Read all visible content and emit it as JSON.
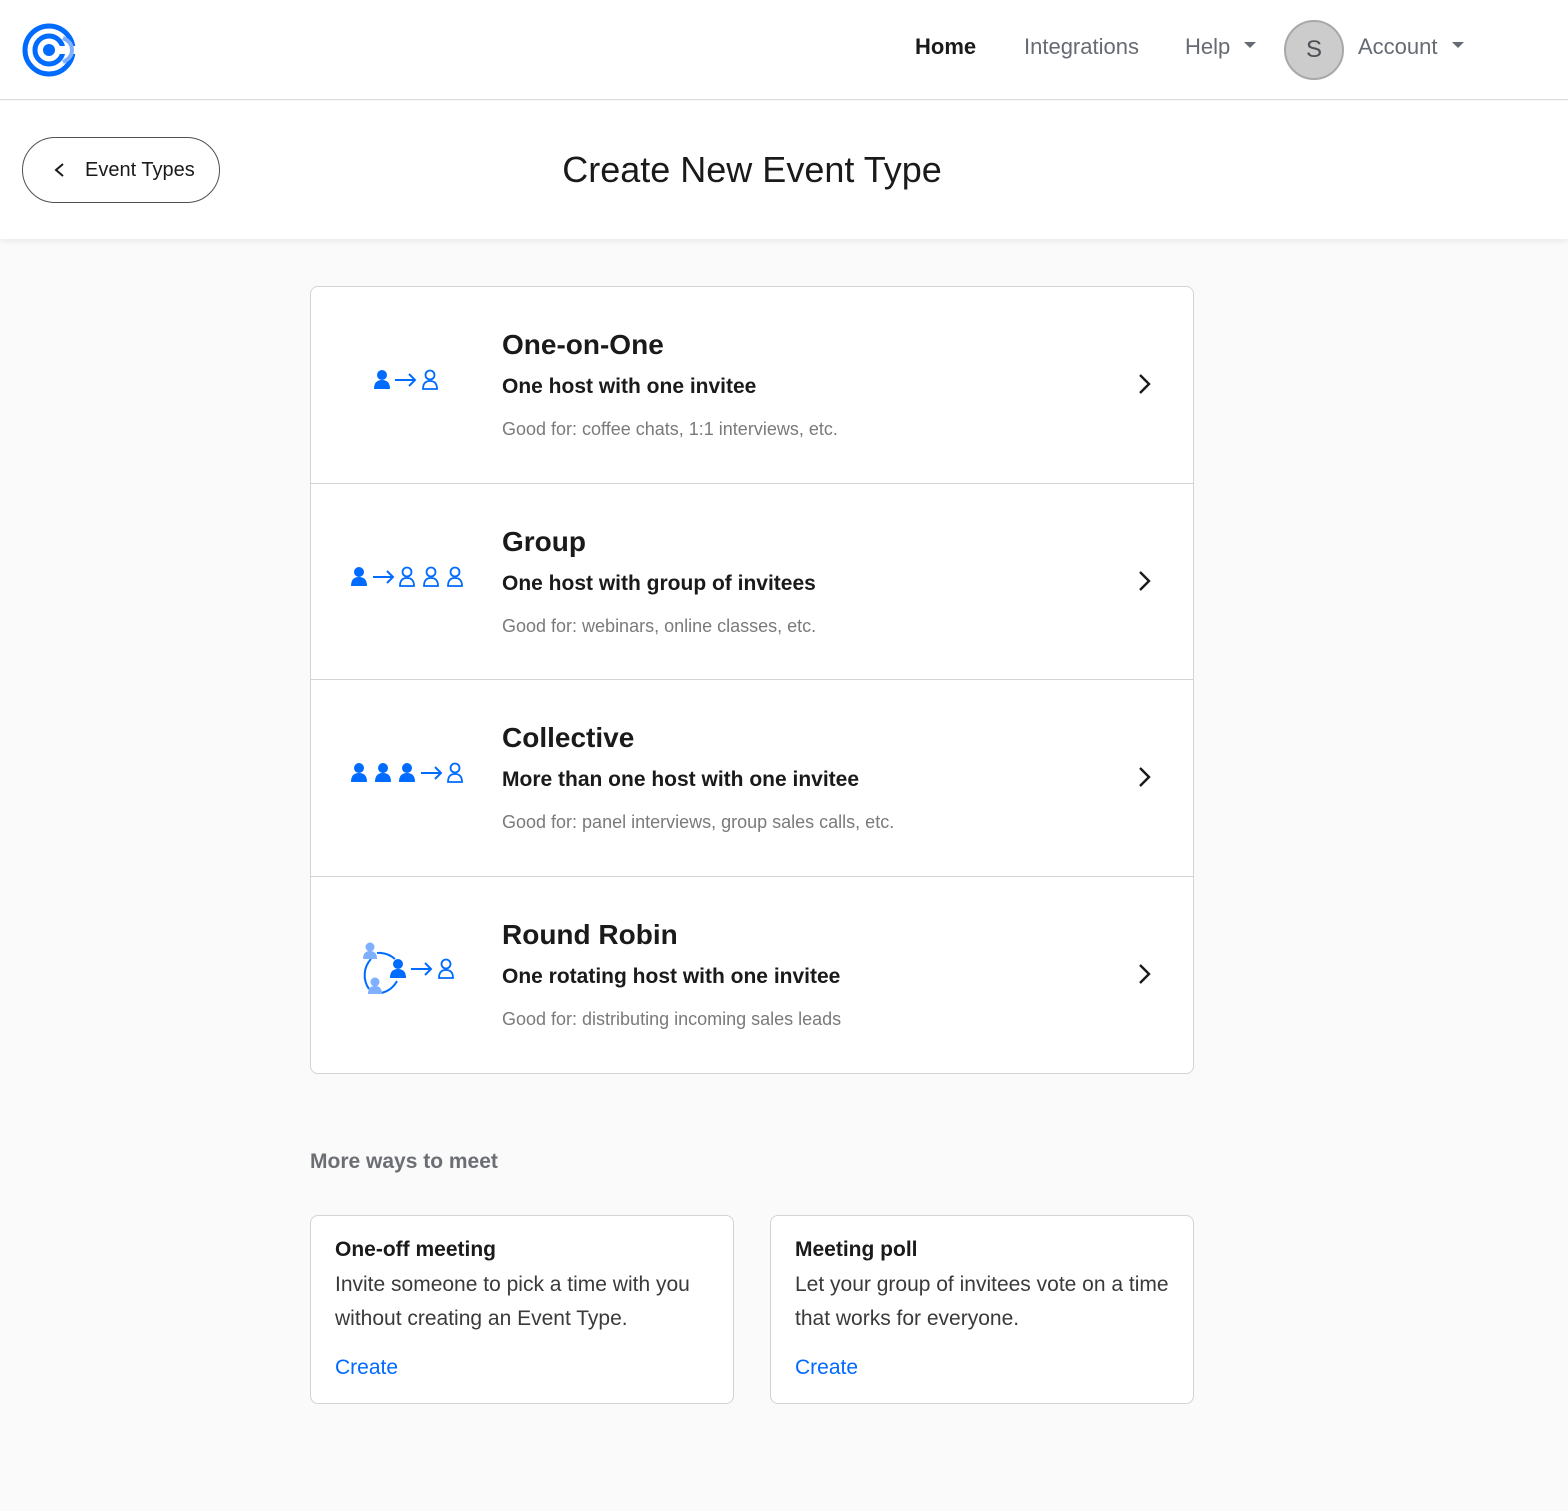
{
  "colors": {
    "brand": "#006bff",
    "brand_light": "#7fb0ff",
    "link": "#0069ff"
  },
  "nav": {
    "logo_icon": "calendly-logo-icon",
    "home": "Home",
    "integrations": "Integrations",
    "help": "Help",
    "avatar_initial": "S",
    "account": "Account"
  },
  "header": {
    "back_label": "Event Types",
    "title": "Create New Event Type"
  },
  "event_types": [
    {
      "title": "One-on-One",
      "subtitle": "One host with one invitee",
      "good_for": "Good for: coffee chats, 1:1 interviews, etc.",
      "icon": "one-on-one-icon"
    },
    {
      "title": "Group",
      "subtitle": "One host with group of invitees",
      "good_for": "Good for: webinars, online classes, etc.",
      "icon": "group-icon"
    },
    {
      "title": "Collective",
      "subtitle": "More than one host with one invitee",
      "good_for": "Good for: panel interviews, group sales calls, etc.",
      "icon": "collective-icon"
    },
    {
      "title": "Round Robin",
      "subtitle": "One rotating host with one invitee",
      "good_for": "Good for: distributing incoming sales leads",
      "icon": "round-robin-icon"
    }
  ],
  "more_ways": {
    "heading": "More ways to meet",
    "cards": [
      {
        "title": "One-off meeting",
        "description": "Invite someone to pick a time with you without creating an Event Type.",
        "link": "Create"
      },
      {
        "title": "Meeting poll",
        "description": "Let your group of invitees vote on a time that works for everyone.",
        "link": "Create"
      }
    ]
  }
}
